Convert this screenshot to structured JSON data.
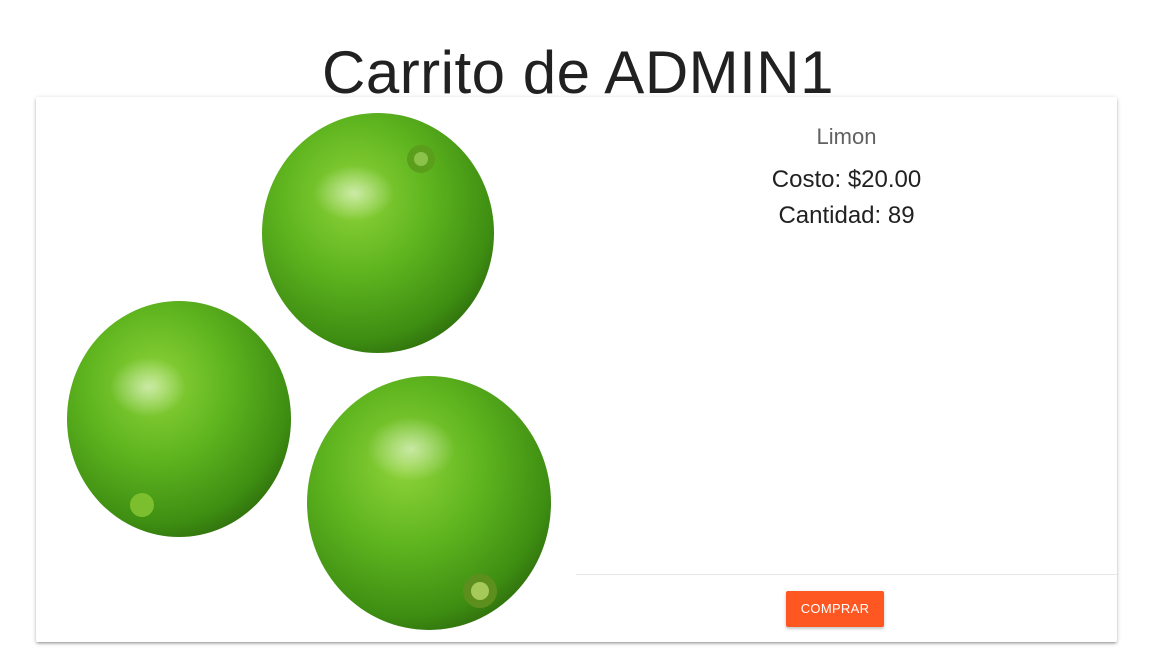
{
  "page": {
    "title": "Carrito de ADMIN1"
  },
  "product": {
    "name": "Limon",
    "cost": "Costo: $20.00",
    "quantity": "Cantidad: 89",
    "image_icon": "limes-image"
  },
  "actions": {
    "buy_label": "COMPRAR"
  },
  "colors": {
    "accent": "#ff5722",
    "lime": "#4caf1a"
  }
}
